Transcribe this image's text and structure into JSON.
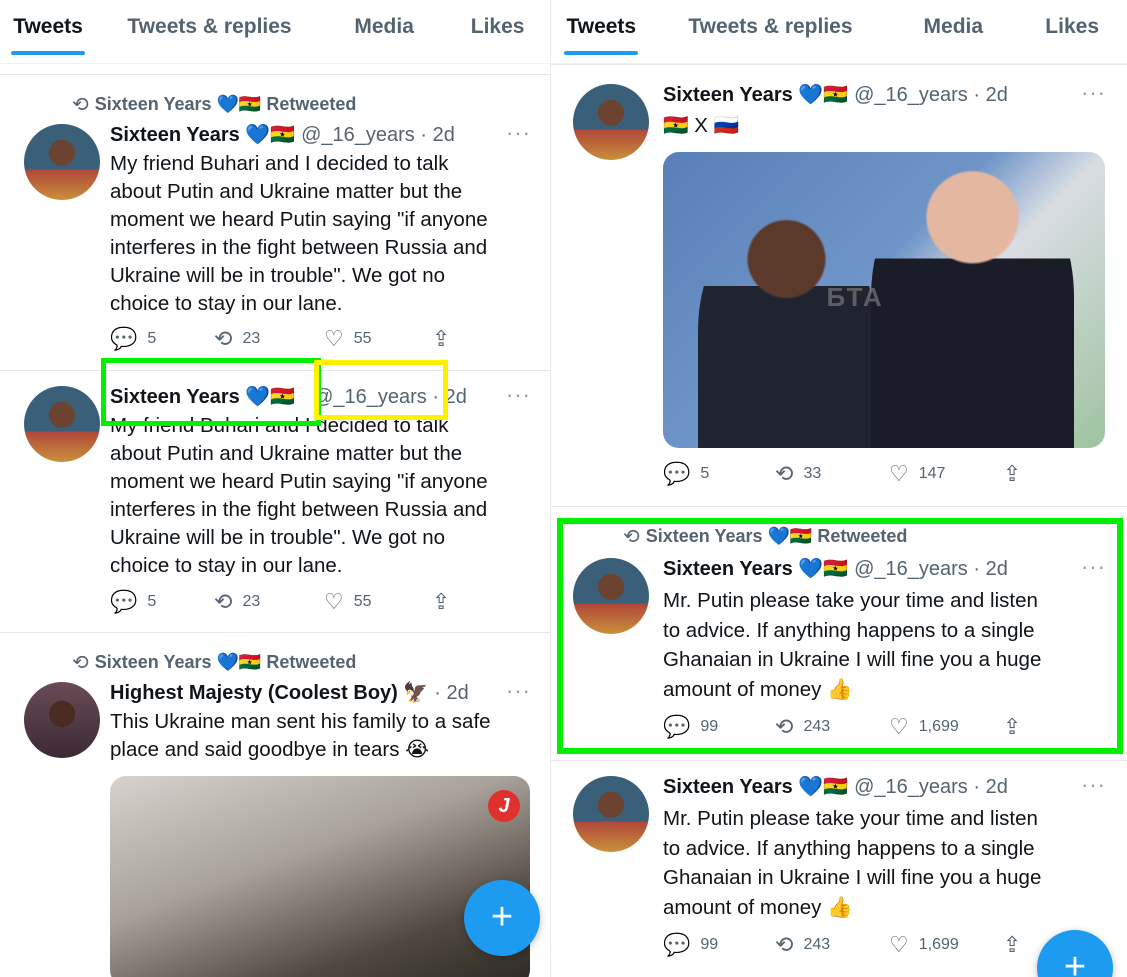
{
  "colors": {
    "accent": "#1d9bf0",
    "highlight_green": "#00f000",
    "highlight_yellow": "#fff200"
  },
  "left": {
    "tabs": [
      "Tweets",
      "Tweets & replies",
      "Media",
      "Likes"
    ],
    "tweets": [
      {
        "retweet_label": "Sixteen Years 💙🇬🇭 Retweeted",
        "name": "Sixteen Years 💙🇬🇭",
        "meta": "@_16_years · 2d",
        "text": "My friend Buhari and I decided to talk\nabout Putin and Ukraine matter but the\nmoment we heard Putin saying \"if anyone\ninterferes in the fight between Russia and\nUkraine will be in trouble\". We got no\nchoice to stay in our lane.",
        "replies": "5",
        "retweets": "23",
        "likes": "55"
      },
      {
        "name": "Sixteen Years 💙🇬🇭",
        "meta": "@_16_years · 2d",
        "text": "My friend Buhari and I decided to talk\nabout Putin and Ukraine matter but the\nmoment we heard Putin saying \"if anyone\ninterferes in the fight between Russia and\nUkraine will be in trouble\". We got no\nchoice to stay in our lane.",
        "replies": "5",
        "retweets": "23",
        "likes": "55"
      },
      {
        "retweet_label": "Sixteen Years 💙🇬🇭 Retweeted",
        "name": "Highest Majesty (Coolest Boy) 🦅",
        "meta": "· 2d",
        "text": "This Ukraine man sent his family to a safe\nplace and said goodbye in tears 😭",
        "media_badge": "J"
      }
    ]
  },
  "right": {
    "tabs": [
      "Tweets",
      "Tweets & replies",
      "Media",
      "Likes"
    ],
    "tweets": [
      {
        "name": "Sixteen Years 💙🇬🇭",
        "meta": "@_16_years · 2d",
        "text": "🇬🇭 X 🇷🇺",
        "media_watermark": "БТА",
        "replies": "5",
        "retweets": "33",
        "likes": "147"
      },
      {
        "retweet_label": "Sixteen Years 💙🇬🇭 Retweeted",
        "name": "Sixteen Years 💙🇬🇭",
        "meta": "@_16_years · 2d",
        "text": "Mr. Putin please take your time and listen\nto advice. If anything happens to a single\nGhanaian in Ukraine I will fine you a huge\namount of money 👍",
        "replies": "99",
        "retweets": "243",
        "likes": "1,699"
      },
      {
        "name": "Sixteen Years 💙🇬🇭",
        "meta": "@_16_years · 2d",
        "text": "Mr. Putin please take your time and listen\nto advice. If anything happens to a single\nGhanaian in Ukraine I will fine you a huge\namount of money 👍",
        "replies": "99",
        "retweets": "243",
        "likes": "1,699"
      }
    ]
  },
  "fab_label": "+",
  "more_label": "···",
  "icons": {
    "retweet": "retweet-icon",
    "reply": "reply-icon",
    "like": "heart-icon",
    "share": "share-icon"
  }
}
